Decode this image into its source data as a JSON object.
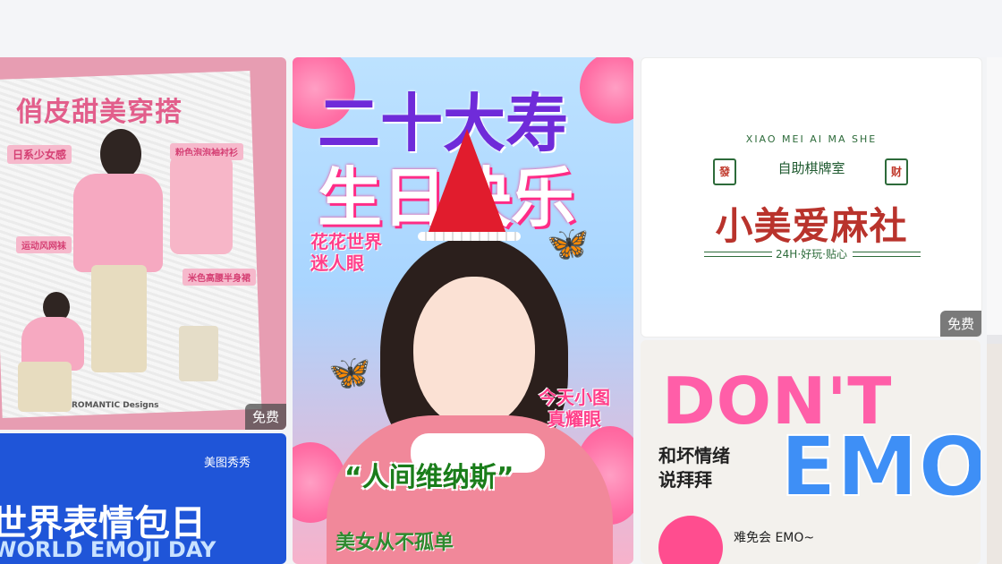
{
  "cards": {
    "c1": {
      "title": "俏皮甜美穿搭",
      "tags": [
        "日系少女感",
        "粉色泡泡袖衬衫",
        "运动风网袜",
        "米色高腰半身裙"
      ],
      "brand": "ROMANTIC Designs",
      "badge": "免费"
    },
    "c2": {
      "logo": "美图秀秀",
      "title": "世界表情包日",
      "subtitle": "WORLD EMOJI DAY"
    },
    "c3": {
      "line1": "二十大寿",
      "line2": "生日快乐",
      "sticker1": "花花世界\n迷人眼",
      "sticker2": "今天小图\n真耀眼",
      "quote": "“人间维纳斯”",
      "bottom": "美女从不孤单"
    },
    "c4": {
      "top": "XIAO MEI AI MA SHE",
      "tile_left": "發",
      "sub": "自助棋牌室",
      "tile_right": "财",
      "name": "小美爱麻社",
      "tagline": "24H·好玩·贴心",
      "badge": "免费"
    },
    "c5": {
      "dont": "DON'T",
      "emo": "EMO",
      "cn": "和坏情绪\n说拜拜",
      "bottom": "难免会 EMO~"
    }
  }
}
